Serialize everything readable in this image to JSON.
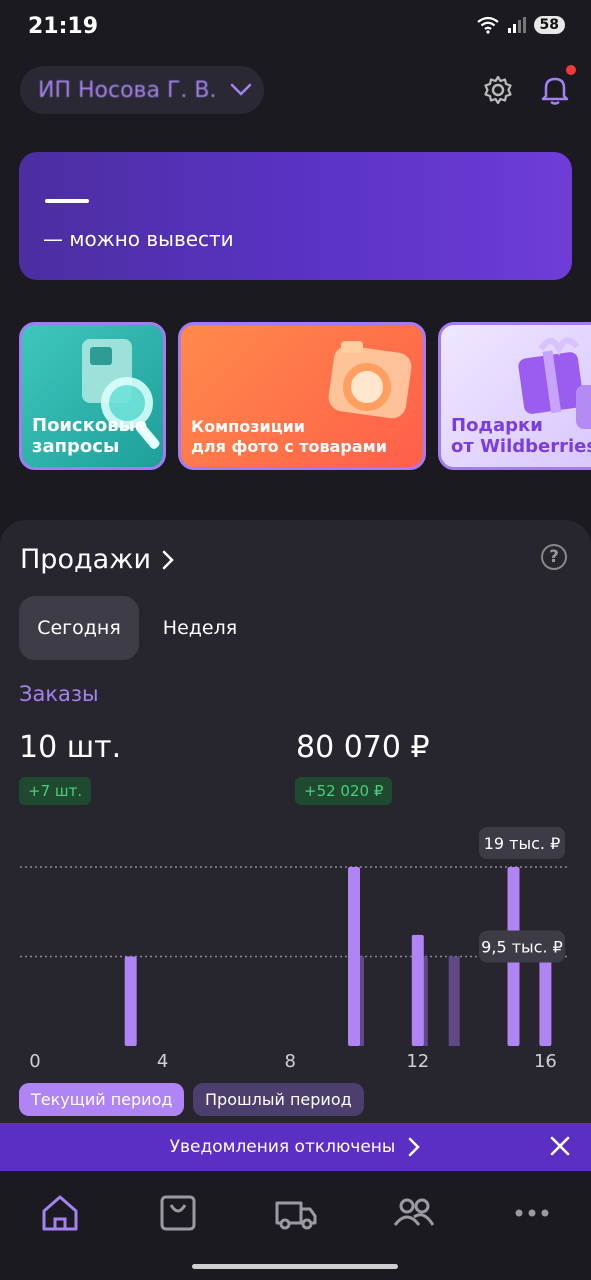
{
  "status_bar": {
    "time": "21:19",
    "battery": "58"
  },
  "header": {
    "seller_name": "ИП Носова Г. В."
  },
  "balance": {
    "amount": "—",
    "withdraw_label": "— можно вывести"
  },
  "stories": [
    {
      "label_line1": "Поисковые",
      "label_line2": "запросы"
    },
    {
      "label_line1": "Композиции",
      "label_line2": "для фото с товарами"
    },
    {
      "label_line1": "Подарки",
      "label_line2": "от Wildberries"
    }
  ],
  "sales": {
    "title": "Продажи",
    "tabs": [
      {
        "label": "Сегодня"
      },
      {
        "label": "Неделя"
      }
    ],
    "orders_label": "Заказы",
    "count": "10 шт.",
    "count_delta": "+7 шт.",
    "sum": "80 070 ₽",
    "sum_delta": "+52 020 ₽",
    "legend_current": "Текущий период",
    "legend_previous": "Прошлый период"
  },
  "chart_data": {
    "type": "bar",
    "x": [
      0,
      1,
      2,
      3,
      4,
      5,
      6,
      7,
      8,
      9,
      10,
      11,
      12,
      13,
      14,
      15,
      16
    ],
    "x_ticks": [
      "0",
      "4",
      "8",
      "12",
      "16"
    ],
    "gridline_labels": [
      "19 тыс. ₽",
      "9,5 тыс. ₽"
    ],
    "gridline_values": [
      19000,
      9500
    ],
    "ylim": [
      0,
      19000
    ],
    "series": [
      {
        "name": "Текущий период",
        "values": [
          0,
          0,
          0,
          9500,
          0,
          0,
          0,
          0,
          0,
          0,
          19000,
          0,
          11800,
          0,
          0,
          19000,
          11700
        ]
      },
      {
        "name": "Прошлый период",
        "values": [
          0,
          0,
          0,
          0,
          0,
          0,
          0,
          0,
          0,
          0,
          9500,
          0,
          9500,
          9500,
          0,
          0,
          0
        ]
      }
    ],
    "colors": {
      "current": "#b084f4",
      "previous": "#5e4a86"
    }
  },
  "notification": {
    "text": "Уведомления отключены"
  },
  "colors": {
    "accent": "#a682f0",
    "banner": "#5c2fc4"
  }
}
